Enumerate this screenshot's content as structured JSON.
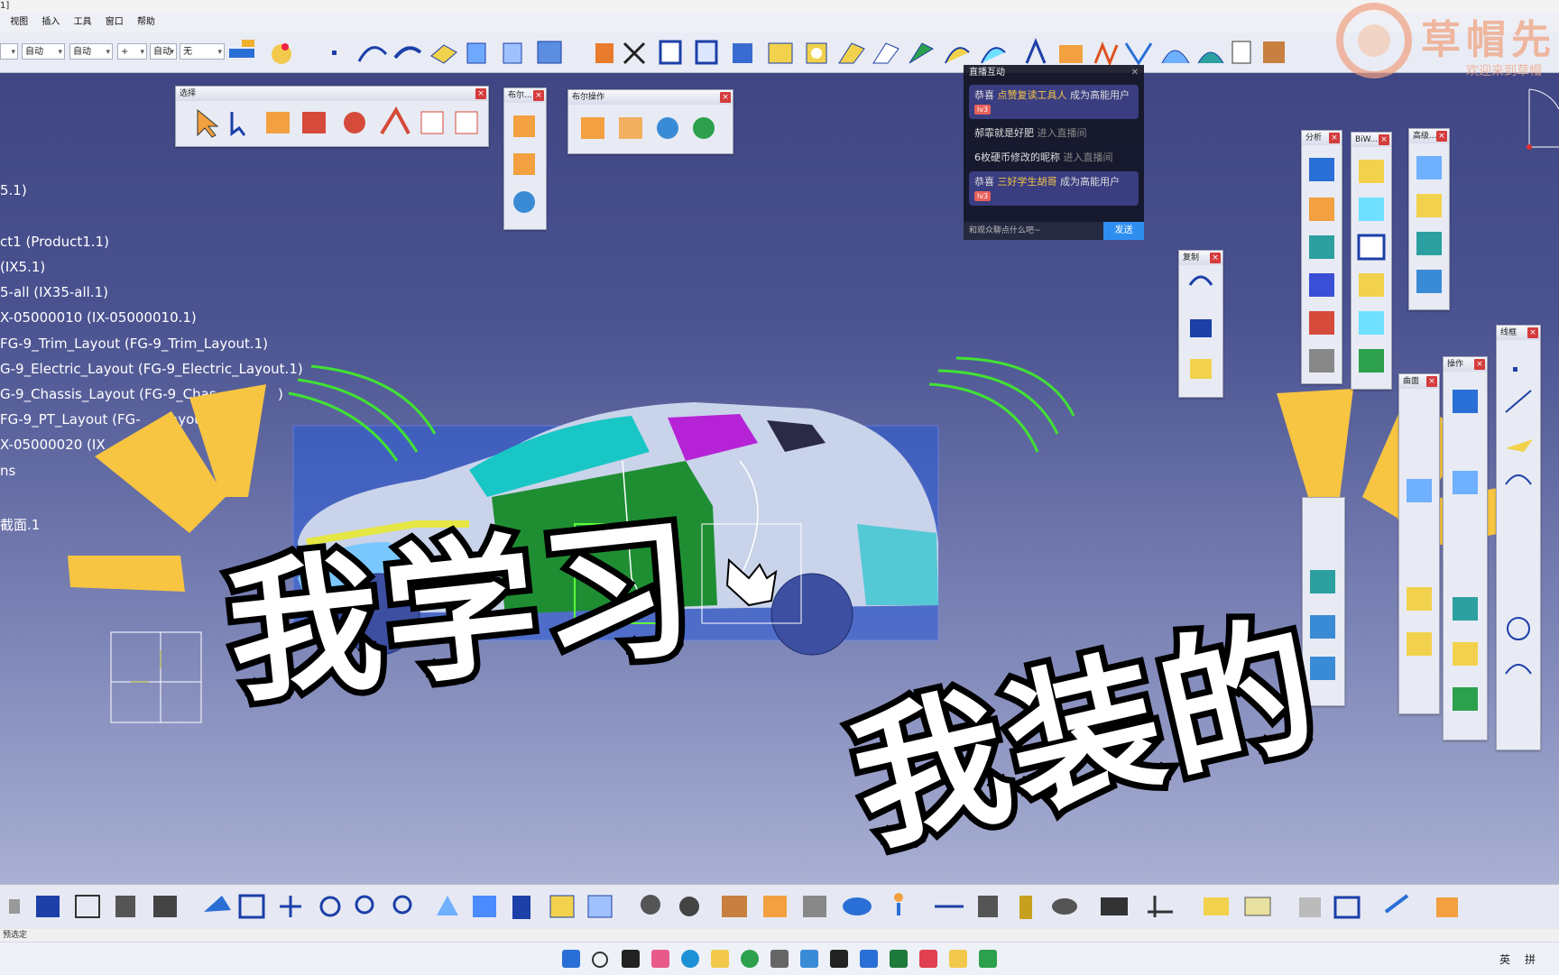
{
  "titlebar": {
    "text": "1]"
  },
  "menu": [
    "视图",
    "插入",
    "工具",
    "窗口",
    "帮助"
  ],
  "toolbar_top": {
    "combos": [
      "",
      "自动",
      "自动",
      "+",
      "自动",
      "无"
    ]
  },
  "tree": {
    "items": [
      "5.1)",
      "ct1 (Product1.1)",
      "(IX5.1)",
      "5-all (IX35-all.1)",
      "X-05000010 (IX-05000010.1)",
      "FG-9_Trim_Layout (FG-9_Trim_Layout.1)",
      "G-9_Electric_Layout (FG-9_Electric_Layout.1)",
      "G-9_Chassis_Layout (FG-9_Chas",
      "FG-9_PT_Layout (FG-",
      "X-05000020 (IX",
      "ns",
      "截面.1"
    ],
    "chassis_tail": ")",
    "pt_tail": "ayout."
  },
  "toolbars": {
    "select": {
      "title": "选择"
    },
    "boolean_small": {
      "title": "布尔..."
    },
    "boolean_ops": {
      "title": "布尔操作"
    },
    "copy": {
      "title": "复制"
    },
    "analysis": {
      "title": "分析"
    },
    "biw": {
      "title": "BiW..."
    },
    "advanced": {
      "title": "高级..."
    },
    "wireframe": {
      "title": "线框"
    },
    "operation": {
      "title": "操作"
    },
    "surface": {
      "title": "曲面"
    }
  },
  "chat": {
    "title": "直播互动",
    "messages": [
      {
        "prefix": "恭喜 ",
        "name": "点赞复读工具人",
        "suffix": " 成为高能用户",
        "badge": "lv3",
        "highlight": true
      },
      {
        "text": "郝霏就是好肥",
        "action": " 进入直播间",
        "highlight": false
      },
      {
        "text": "6枚硬币修改的昵称",
        "action": " 进入直播间",
        "highlight": false
      },
      {
        "prefix": "恭喜 ",
        "name": "三好学生胡哥",
        "suffix": " 成为高能用户",
        "badge": "lv3",
        "highlight": true
      }
    ],
    "input_placeholder": "和观众聊点什么吧~",
    "send_label": "发送"
  },
  "watermark": {
    "title": "草帽先",
    "subtitle": "欢迎来到草帽"
  },
  "caption": {
    "left": "我学习",
    "right": "我装的"
  },
  "statusbar": {
    "text": "预选定"
  },
  "taskbar_tray": [
    "英",
    "拼"
  ],
  "colors": {
    "viewport_top": "#3f4683",
    "caption_fill": "#ffffff",
    "burst": "#f7c542",
    "chat_send": "#2e8ff0"
  }
}
